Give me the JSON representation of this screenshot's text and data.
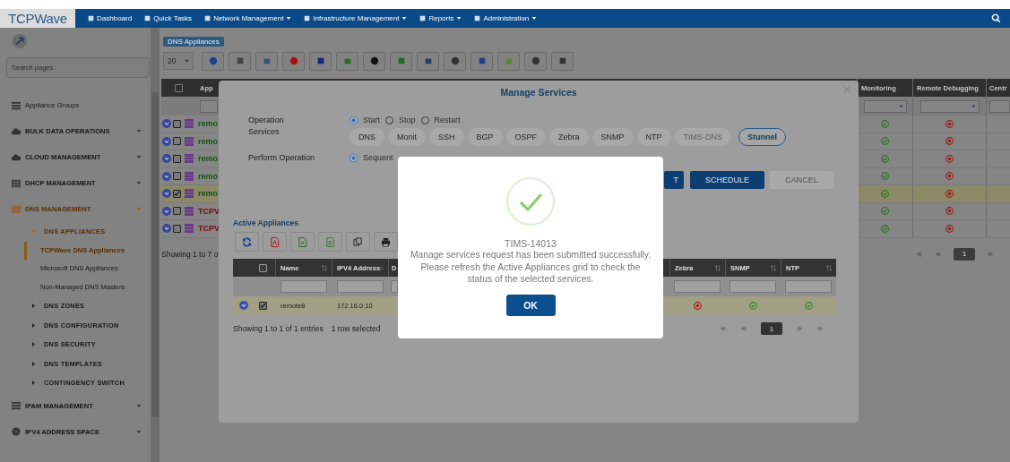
{
  "nav": {
    "logo": "TCPWave",
    "items": [
      {
        "label": "Dashboard",
        "dropdown": false
      },
      {
        "label": "Quick Tasks",
        "dropdown": false
      },
      {
        "label": "Network Management",
        "dropdown": true
      },
      {
        "label": "Infrastructure Management",
        "dropdown": true
      },
      {
        "label": "Reports",
        "dropdown": true
      },
      {
        "label": "Administration",
        "dropdown": true
      }
    ]
  },
  "sidebar": {
    "search": {
      "placeholder": "Search pages"
    },
    "items": [
      {
        "label": "Appliance Groups",
        "dropdown": false,
        "expanded": false,
        "caps": false
      },
      {
        "label": "BULK DATA OPERATIONS",
        "dropdown": true,
        "expanded": false,
        "caps": true
      },
      {
        "label": "CLOUD MANAGEMENT",
        "dropdown": true,
        "expanded": false,
        "caps": true
      },
      {
        "label": "DHCP MANAGEMENT",
        "dropdown": true,
        "expanded": false,
        "caps": true
      },
      {
        "label": "DNS MANAGEMENT",
        "dropdown": true,
        "expanded": true,
        "caps": true,
        "children": [
          {
            "label": "DNS APPLIANCES",
            "expanded": true,
            "children": [
              {
                "label": "TCPWave DNS Appliances",
                "selected": true
              },
              {
                "label": "Microsoft DNS Appliances",
                "selected": false
              },
              {
                "label": "Non-Managed DNS Masters",
                "selected": false
              }
            ]
          },
          {
            "label": "DNS ZONES",
            "expanded": false
          },
          {
            "label": "DNS CONFIGURATION",
            "expanded": false
          },
          {
            "label": "DNS SECURITY",
            "expanded": false
          },
          {
            "label": "DNS TEMPLATES",
            "expanded": false
          },
          {
            "label": "CONTINGENCY SWITCH",
            "expanded": false
          }
        ]
      },
      {
        "label": "IPAM MANAGEMENT",
        "dropdown": true,
        "expanded": false,
        "caps": true
      },
      {
        "label": "IPV4 ADDRESS SPACE",
        "dropdown": true,
        "expanded": false,
        "caps": true
      }
    ]
  },
  "breadcrumb": "DNS Appliances",
  "page_size": "20",
  "appliances": {
    "columns": [
      "App",
      "Monitoring",
      "Remote Debugging",
      "Centr"
    ],
    "header_checked": false,
    "rows": [
      {
        "name": "remo",
        "color": "#145214",
        "checked": false,
        "selected": false,
        "monitoring_ok": true,
        "remote_debugging_ok": false
      },
      {
        "name": "remo",
        "color": "#145214",
        "checked": false,
        "selected": false,
        "monitoring_ok": true,
        "remote_debugging_ok": false
      },
      {
        "name": "remo",
        "color": "#145214",
        "checked": false,
        "selected": false,
        "monitoring_ok": true,
        "remote_debugging_ok": false
      },
      {
        "name": "remo",
        "color": "#145214",
        "checked": false,
        "selected": false,
        "monitoring_ok": true,
        "remote_debugging_ok": false
      },
      {
        "name": "remo",
        "color": "#145214",
        "checked": true,
        "selected": true,
        "monitoring_ok": true,
        "remote_debugging_ok": false
      },
      {
        "name": "TCPV",
        "color": "#700c0c",
        "checked": false,
        "selected": false,
        "monitoring_ok": true,
        "remote_debugging_ok": false
      },
      {
        "name": "TCPV",
        "color": "#700c0c",
        "checked": false,
        "selected": false,
        "monitoring_ok": true,
        "remote_debugging_ok": false
      }
    ],
    "footer": "Showing 1 to 7 o",
    "pages": [
      {
        "label": "1",
        "selected": true
      }
    ]
  },
  "modal": {
    "title": "Manage Services",
    "operation": {
      "label": "Operation",
      "options": [
        {
          "label": "Start",
          "selected": true
        },
        {
          "label": "Stop",
          "selected": false
        },
        {
          "label": "Restart",
          "selected": false
        }
      ]
    },
    "services": {
      "label": "Services",
      "items": [
        {
          "label": "DNS",
          "selected": false,
          "disabled": false
        },
        {
          "label": "Monit",
          "selected": false,
          "disabled": false
        },
        {
          "label": "SSH",
          "selected": false,
          "disabled": false
        },
        {
          "label": "BGP",
          "selected": false,
          "disabled": false
        },
        {
          "label": "OSPF",
          "selected": false,
          "disabled": false
        },
        {
          "label": "Zebra",
          "selected": false,
          "disabled": false
        },
        {
          "label": "SNMP",
          "selected": false,
          "disabled": false
        },
        {
          "label": "NTP",
          "selected": false,
          "disabled": false
        },
        {
          "label": "TIMS-DNS",
          "selected": false,
          "disabled": true
        },
        {
          "label": "Stunnel",
          "selected": true,
          "disabled": false
        }
      ]
    },
    "perform": {
      "label": "Perform Operation",
      "options": [
        {
          "label": "Sequent",
          "selected": true
        }
      ]
    },
    "buttons": [
      {
        "label": "T",
        "disabled": false
      },
      {
        "label": "SCHEDULE",
        "disabled": false
      },
      {
        "label": "CANCEL",
        "disabled": true
      }
    ],
    "active": {
      "title": "Active Appliances",
      "header_checked": false,
      "left_columns": [
        "Name",
        "IPV4 Address",
        "D"
      ],
      "right_columns": [
        "Zebra",
        "SNMP",
        "NTP"
      ],
      "rows": [
        {
          "checked": true,
          "selected": true,
          "name": "remote8",
          "ipv4": "172.16.0.10",
          "zebra_ok": false,
          "snmp_ok": true,
          "ntp_ok": true
        }
      ],
      "footer": "Showing 1 to 1 of 1 entries",
      "selection": "1 row selected",
      "pages": [
        {
          "label": "1",
          "selected": true
        }
      ]
    }
  },
  "dialog": {
    "code": "TIMS-14013",
    "message": "Manage services request has been submitted successfully. Please refresh the Active Appliances grid to check the status of the selected services.",
    "button": "OK"
  }
}
